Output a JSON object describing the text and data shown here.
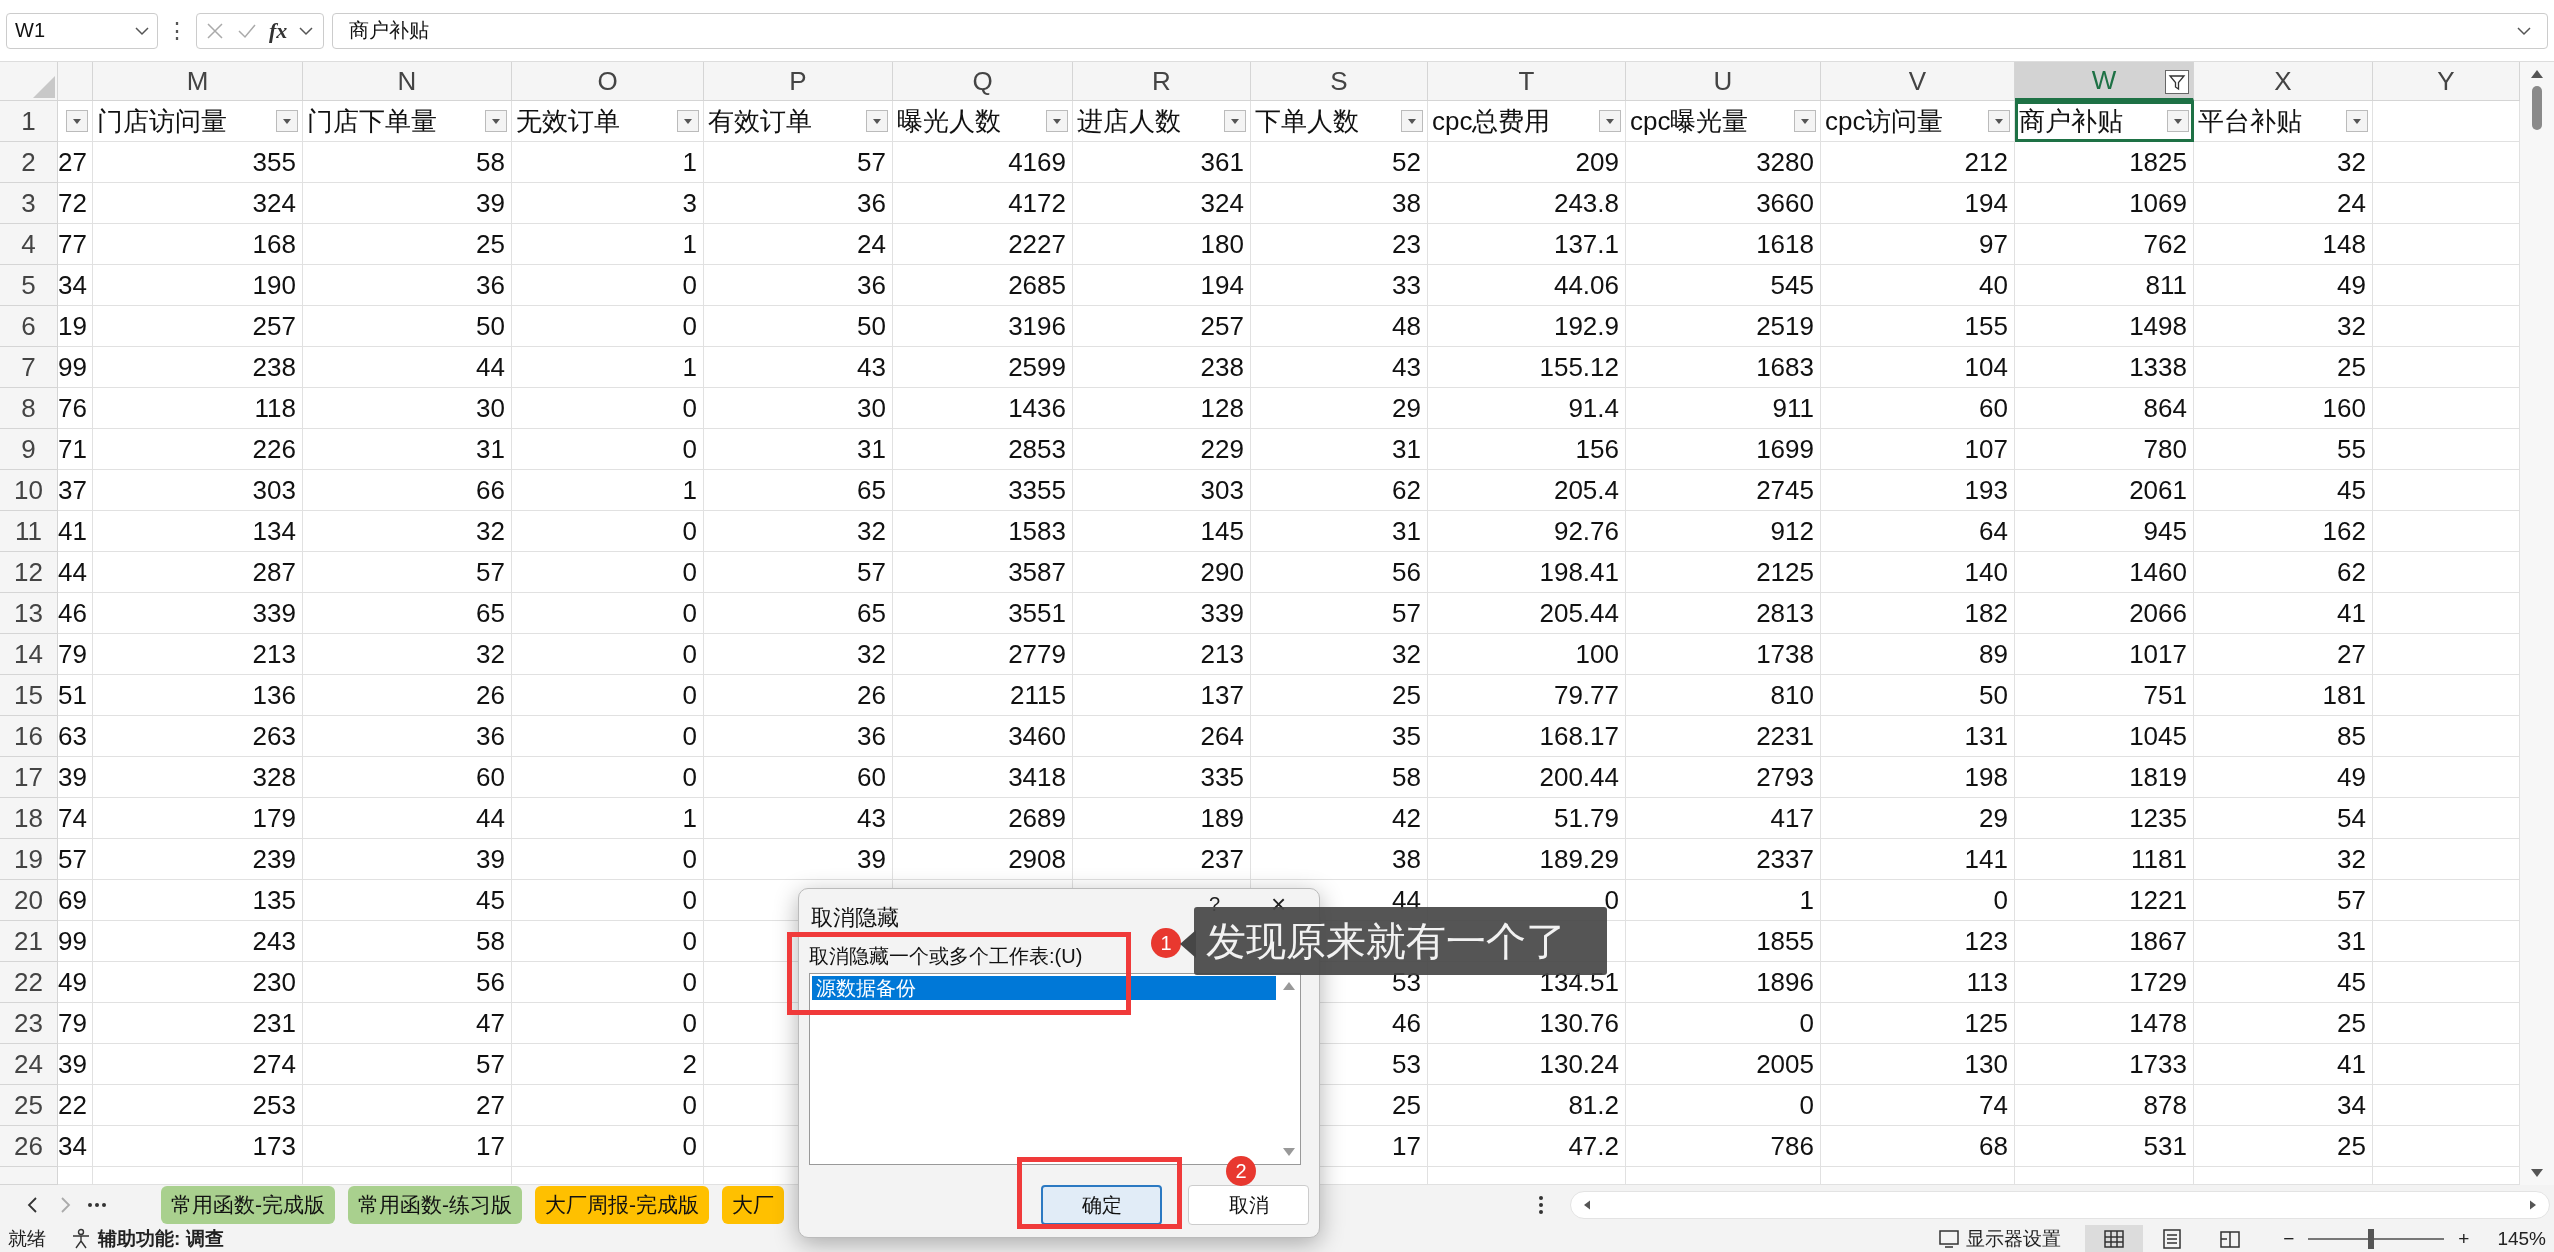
{
  "formula_bar": {
    "name_box": "W1",
    "more": "⋮",
    "function_label": "fx",
    "formula": "商户补贴"
  },
  "columns": [
    {
      "letter": "M",
      "selected": false,
      "filtered": false
    },
    {
      "letter": "N",
      "selected": false,
      "filtered": false
    },
    {
      "letter": "O",
      "selected": false,
      "filtered": false
    },
    {
      "letter": "P",
      "selected": false,
      "filtered": false
    },
    {
      "letter": "Q",
      "selected": false,
      "filtered": false
    },
    {
      "letter": "R",
      "selected": false,
      "filtered": false
    },
    {
      "letter": "S",
      "selected": false,
      "filtered": false
    },
    {
      "letter": "T",
      "selected": false,
      "filtered": false
    },
    {
      "letter": "U",
      "selected": false,
      "filtered": false
    },
    {
      "letter": "V",
      "selected": false,
      "filtered": false
    },
    {
      "letter": "W",
      "selected": true,
      "filtered": true
    },
    {
      "letter": "X",
      "selected": false,
      "filtered": false
    },
    {
      "letter": "Y",
      "selected": false,
      "filtered": false
    }
  ],
  "header_row": {
    "number": "1",
    "cells": [
      {
        "text": null,
        "filter": true,
        "selected": false
      },
      {
        "text": "门店访问量",
        "filter": true,
        "selected": false
      },
      {
        "text": "门店下单量",
        "filter": true,
        "selected": false
      },
      {
        "text": "无效订单",
        "filter": true,
        "selected": false
      },
      {
        "text": "有效订单",
        "filter": true,
        "selected": false
      },
      {
        "text": "曝光人数",
        "filter": true,
        "selected": false
      },
      {
        "text": "进店人数",
        "filter": true,
        "selected": false
      },
      {
        "text": "下单人数",
        "filter": true,
        "selected": false
      },
      {
        "text": "cpc总费用",
        "filter": true,
        "selected": false
      },
      {
        "text": "cpc曝光量",
        "filter": true,
        "selected": false
      },
      {
        "text": "cpc访问量",
        "filter": true,
        "selected": false
      },
      {
        "text": "商户补贴",
        "filter": true,
        "selected": true
      },
      {
        "text": "平台补贴",
        "filter": true,
        "selected": false
      }
    ]
  },
  "rows": [
    {
      "number": "2",
      "cells": [
        "27",
        "355",
        "58",
        "1",
        "57",
        "4169",
        "361",
        "52",
        "209",
        "3280",
        "212",
        "1825",
        "32"
      ]
    },
    {
      "number": "3",
      "cells": [
        "72",
        "324",
        "39",
        "3",
        "36",
        "4172",
        "324",
        "38",
        "243.8",
        "3660",
        "194",
        "1069",
        "24"
      ]
    },
    {
      "number": "4",
      "cells": [
        "77",
        "168",
        "25",
        "1",
        "24",
        "2227",
        "180",
        "23",
        "137.1",
        "1618",
        "97",
        "762",
        "148"
      ]
    },
    {
      "number": "5",
      "cells": [
        "34",
        "190",
        "36",
        "0",
        "36",
        "2685",
        "194",
        "33",
        "44.06",
        "545",
        "40",
        "811",
        "49"
      ]
    },
    {
      "number": "6",
      "cells": [
        "19",
        "257",
        "50",
        "0",
        "50",
        "3196",
        "257",
        "48",
        "192.9",
        "2519",
        "155",
        "1498",
        "32"
      ]
    },
    {
      "number": "7",
      "cells": [
        "99",
        "238",
        "44",
        "1",
        "43",
        "2599",
        "238",
        "43",
        "155.12",
        "1683",
        "104",
        "1338",
        "25"
      ]
    },
    {
      "number": "8",
      "cells": [
        "76",
        "118",
        "30",
        "0",
        "30",
        "1436",
        "128",
        "29",
        "91.4",
        "911",
        "60",
        "864",
        "160"
      ]
    },
    {
      "number": "9",
      "cells": [
        "71",
        "226",
        "31",
        "0",
        "31",
        "2853",
        "229",
        "31",
        "156",
        "1699",
        "107",
        "780",
        "55"
      ]
    },
    {
      "number": "10",
      "cells": [
        "37",
        "303",
        "66",
        "1",
        "65",
        "3355",
        "303",
        "62",
        "205.4",
        "2745",
        "193",
        "2061",
        "45"
      ]
    },
    {
      "number": "11",
      "cells": [
        "41",
        "134",
        "32",
        "0",
        "32",
        "1583",
        "145",
        "31",
        "92.76",
        "912",
        "64",
        "945",
        "162"
      ]
    },
    {
      "number": "12",
      "cells": [
        "44",
        "287",
        "57",
        "0",
        "57",
        "3587",
        "290",
        "56",
        "198.41",
        "2125",
        "140",
        "1460",
        "62"
      ]
    },
    {
      "number": "13",
      "cells": [
        "46",
        "339",
        "65",
        "0",
        "65",
        "3551",
        "339",
        "57",
        "205.44",
        "2813",
        "182",
        "2066",
        "41"
      ]
    },
    {
      "number": "14",
      "cells": [
        "79",
        "213",
        "32",
        "0",
        "32",
        "2779",
        "213",
        "32",
        "100",
        "1738",
        "89",
        "1017",
        "27"
      ]
    },
    {
      "number": "15",
      "cells": [
        "51",
        "136",
        "26",
        "0",
        "26",
        "2115",
        "137",
        "25",
        "79.77",
        "810",
        "50",
        "751",
        "181"
      ]
    },
    {
      "number": "16",
      "cells": [
        "63",
        "263",
        "36",
        "0",
        "36",
        "3460",
        "264",
        "35",
        "168.17",
        "2231",
        "131",
        "1045",
        "85"
      ]
    },
    {
      "number": "17",
      "cells": [
        "39",
        "328",
        "60",
        "0",
        "60",
        "3418",
        "335",
        "58",
        "200.44",
        "2793",
        "198",
        "1819",
        "49"
      ]
    },
    {
      "number": "18",
      "cells": [
        "74",
        "179",
        "44",
        "1",
        "43",
        "2689",
        "189",
        "42",
        "51.79",
        "417",
        "29",
        "1235",
        "54"
      ]
    },
    {
      "number": "19",
      "cells": [
        "57",
        "239",
        "39",
        "0",
        "39",
        "2908",
        "237",
        "38",
        "189.29",
        "2337",
        "141",
        "1181",
        "32"
      ]
    },
    {
      "number": "20",
      "cells": [
        "69",
        "135",
        "45",
        "0",
        null,
        null,
        null,
        "44",
        "0",
        "1",
        "0",
        "1221",
        "57"
      ]
    },
    {
      "number": "21",
      "cells": [
        "99",
        "243",
        "58",
        "0",
        null,
        null,
        null,
        null,
        null,
        "1855",
        "123",
        "1867",
        "31"
      ]
    },
    {
      "number": "22",
      "cells": [
        "49",
        "230",
        "56",
        "0",
        null,
        null,
        null,
        "53",
        "134.51",
        "1896",
        "113",
        "1729",
        "45"
      ]
    },
    {
      "number": "23",
      "cells": [
        "79",
        "231",
        "47",
        "0",
        null,
        null,
        null,
        "46",
        "130.76",
        "0",
        "125",
        "1478",
        "25"
      ]
    },
    {
      "number": "24",
      "cells": [
        "39",
        "274",
        "57",
        "2",
        null,
        null,
        null,
        "53",
        "130.24",
        "2005",
        "130",
        "1733",
        "41"
      ]
    },
    {
      "number": "25",
      "cells": [
        "22",
        "253",
        "27",
        "0",
        null,
        null,
        null,
        "25",
        "81.2",
        "0",
        "74",
        "878",
        "34"
      ]
    },
    {
      "number": "26",
      "cells": [
        "34",
        "173",
        "17",
        "0",
        null,
        null,
        null,
        "17",
        "47.2",
        "786",
        "68",
        "531",
        "25"
      ]
    }
  ],
  "sheet_tabs": [
    {
      "label": "常用函数-完成版",
      "color": "#a9d08e"
    },
    {
      "label": "常用函数-练习版",
      "color": "#a9d08e"
    },
    {
      "label": "大厂周报-完成版",
      "color": "#ffc000"
    },
    {
      "label": "大厂",
      "color": "#ffc000"
    }
  ],
  "status_bar": {
    "ready": "就绪",
    "accessibility": "辅助功能: 调查",
    "display_settings": "显示器设置",
    "views": [
      {
        "kind": "normal",
        "selected": true
      },
      {
        "kind": "page_layout",
        "selected": false
      },
      {
        "kind": "page_break",
        "selected": false
      }
    ],
    "zoom": {
      "level": 0.46,
      "minus": "−",
      "plus": "+",
      "percent": "145%"
    }
  },
  "dialog": {
    "title": "取消隐藏",
    "help": "?",
    "close": "×",
    "label": "取消隐藏一个或多个工作表:(U)",
    "items": [
      {
        "text": "源数据备份",
        "selected": true
      }
    ],
    "buttons": [
      {
        "label": "确定",
        "default": true
      },
      {
        "label": "取消",
        "default": false
      }
    ]
  },
  "annotations": {
    "badges": [
      "1",
      "2"
    ],
    "callout": "发现原来就有一个了"
  }
}
